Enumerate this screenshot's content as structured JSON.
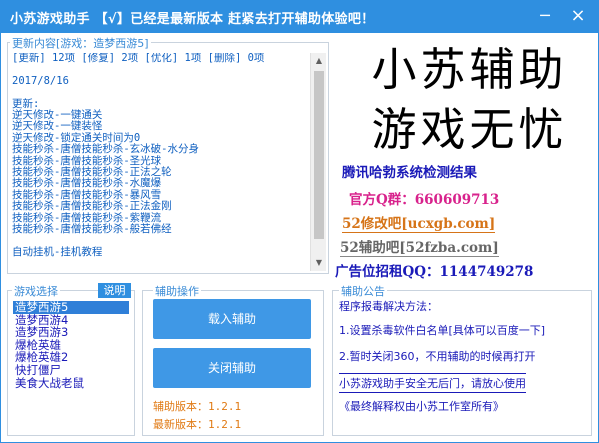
{
  "window": {
    "title": "小苏游戏助手 【√】已经是最新版本 赶紧去打开辅助体验吧！",
    "minimize_glyph": "─",
    "close_glyph": "×"
  },
  "update_log": {
    "legend": "更新内容[游戏：造梦西游5]",
    "text": "[更新] 12项 [修复] 2项 [优化] 1项 [删除] 0项\n\n2017/8/16\n\n更新:\n逆天修改-一键通关\n逆天修改-一键装怪\n逆天修改-锁定通关时间为0\n技能秒杀-唐僧技能秒杀-玄冰破-水分身\n技能秒杀-唐僧技能秒杀-圣光球\n技能秒杀-唐僧技能秒杀-正法之轮\n技能秒杀-唐僧技能秒杀-水魔爆\n技能秒杀-唐僧技能秒杀-暴风雪\n技能秒杀-唐僧技能秒杀-正法金刚\n技能秒杀-唐僧技能秒杀-紫鞭流\n技能秒杀-唐僧技能秒杀-般若佛经\n\n自动挂机-挂机教程"
  },
  "ad": {
    "line1": "小苏辅助",
    "line2": "游戏无忧",
    "tencent": "腾讯哈勃系统检测结果",
    "qq_group": "官方Q群：660609713",
    "site_52xg": "52修改吧[ucxgb.com]",
    "site_52fz": "52辅助吧[52fzba.com]",
    "ad_contact": "广告位招租QQ：1144749278"
  },
  "game_select": {
    "legend": "游戏选择",
    "help_label": "说明",
    "games": [
      "造梦西游5",
      "造梦西游4",
      "造梦西游3",
      "爆枪英雄",
      "爆枪英雄2",
      "快打僵尸",
      "美食大战老鼠"
    ],
    "selected_index": 0
  },
  "operation": {
    "legend": "辅助操作",
    "inject_label": "载入辅助",
    "close_label": "关闭辅助",
    "assist_version": "辅助版本：1.2.1",
    "latest_version": "最新版本：1.2.1"
  },
  "notice": {
    "legend": "辅助公告",
    "line1": "程序报毒解决方法：",
    "line2": "1.设置杀毒软件白名单[具体可以百度一下]",
    "line3": "2.暂时关闭360，不用辅助的时候再打开",
    "line4": "小苏游戏助手安全无后门，请放心使用",
    "line5": "《最终解释权由小苏工作室所有》"
  },
  "colors": {
    "titlebar": "#2f8fe0",
    "link_blue": "#1a1ab8",
    "qq_pink": "#d8228c",
    "orange": "#e07a14"
  }
}
